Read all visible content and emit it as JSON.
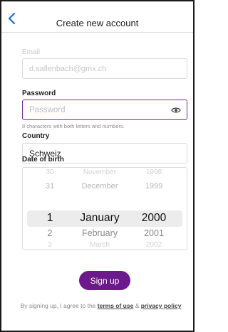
{
  "header": {
    "title": "Create new account",
    "back_icon": "chevron-left-icon"
  },
  "email": {
    "label": "Email",
    "value": "d.sallenbach@gmx.ch"
  },
  "password": {
    "label": "Password",
    "placeholder": "Password",
    "hint": "8 characters with both letters and numbers.",
    "visibility_icon": "eye-icon"
  },
  "country": {
    "label": "Country",
    "value": "Schweiz"
  },
  "dob": {
    "label": "Date of birth",
    "days": {
      "far_prev": "30",
      "prev": "31",
      "selected": "1",
      "next": "2",
      "far_next": "3"
    },
    "months": {
      "far_prev": "November",
      "prev": "December",
      "selected": "January",
      "next": "February",
      "far_next": "March"
    },
    "years": {
      "far_prev": "1998",
      "prev": "1999",
      "selected": "2000",
      "next": "2001",
      "far_next": "2002"
    }
  },
  "signup": {
    "label": "Sign up"
  },
  "terms": {
    "prefix": "By signing up, I agree to the ",
    "terms_link": "terms of use",
    "joiner": " & ",
    "privacy_link": "privacy policy"
  },
  "colors": {
    "accent": "#6c1a8b",
    "focus_border": "#7b2a9e",
    "back_arrow": "#1e6fd9"
  }
}
